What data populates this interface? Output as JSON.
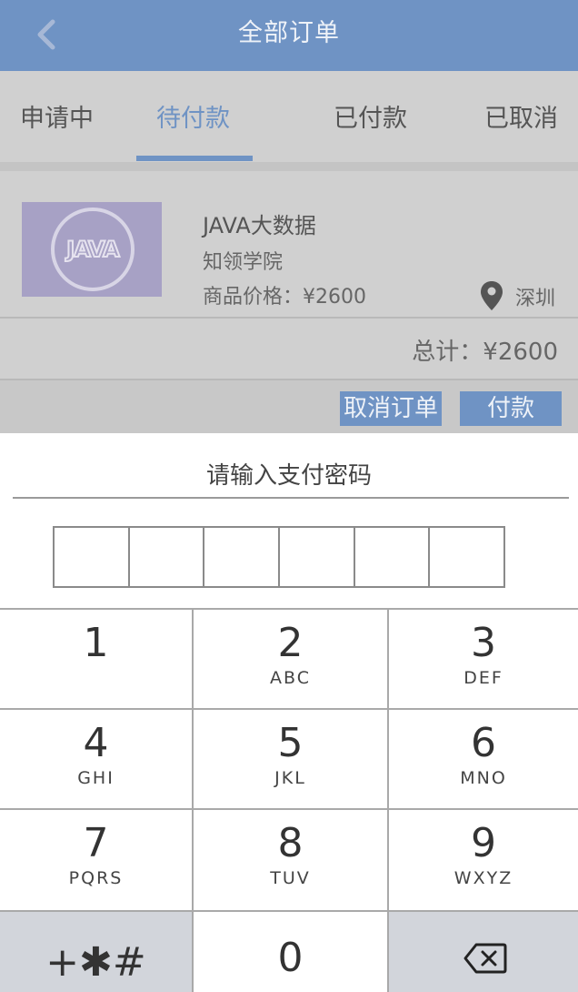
{
  "header": {
    "title": "全部订单",
    "back_icon": "chevron-left-icon"
  },
  "tabs": [
    {
      "label": "申请中",
      "active": false
    },
    {
      "label": "待付款",
      "active": true
    },
    {
      "label": "已付款",
      "active": false
    },
    {
      "label": "已取消",
      "active": false
    }
  ],
  "order": {
    "logo_text": "JAVA",
    "name": "JAVA大数据",
    "school": "知领学院",
    "price": "商品价格：¥2600",
    "city": "深圳",
    "total": "总计：¥2600",
    "cancel_label": "取消订单",
    "pay_label": "付款"
  },
  "password_sheet": {
    "title": "请输入支付密码",
    "digits_entered": 0,
    "digit_count": 6
  },
  "keypad": {
    "keys": [
      {
        "num": "1",
        "letters": ""
      },
      {
        "num": "2",
        "letters": "ABC"
      },
      {
        "num": "3",
        "letters": "DEF"
      },
      {
        "num": "4",
        "letters": "GHI"
      },
      {
        "num": "5",
        "letters": "JKL"
      },
      {
        "num": "6",
        "letters": "MNO"
      },
      {
        "num": "7",
        "letters": "PQRS"
      },
      {
        "num": "8",
        "letters": "TUV"
      },
      {
        "num": "9",
        "letters": "WXYZ"
      }
    ],
    "symbols": "+✱#",
    "zero": "0",
    "backspace_icon": "backspace-icon"
  },
  "colors": {
    "accent": "#6f93c4",
    "overlay_gray": "#d0d0d0",
    "keypad_gray": "#d2d5db"
  }
}
